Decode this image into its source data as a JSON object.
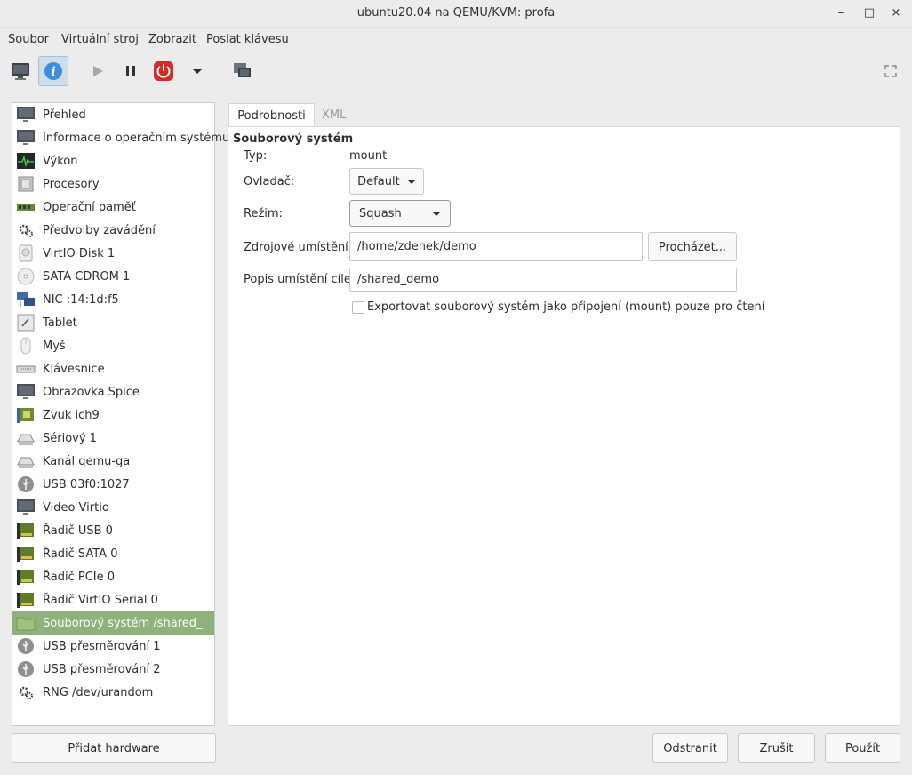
{
  "window": {
    "title": "ubuntu20.04 na QEMU/KVM: profa",
    "controls": [
      "–",
      "□",
      "×"
    ]
  },
  "menubar": {
    "items": [
      "Soubor",
      "Virtuální stroj",
      "Zobrazit",
      "Poslat klávesu"
    ]
  },
  "toolbar": {
    "buttons": [
      "console-icon",
      "info-icon",
      "play-icon",
      "pause-icon",
      "power-icon",
      "dropdown-arrow-icon",
      "snapshots-icon",
      "fullscreen-icon"
    ]
  },
  "sidebar": {
    "items": [
      {
        "label": "Přehled",
        "icon": "monitor-icon"
      },
      {
        "label": "Informace o operačním systému",
        "icon": "monitor-icon"
      },
      {
        "label": "Výkon",
        "icon": "performance-icon"
      },
      {
        "label": "Procesory",
        "icon": "cpu-icon"
      },
      {
        "label": "Operační paměť",
        "icon": "memory-icon"
      },
      {
        "label": "Předvolby zavádění",
        "icon": "gear-icon"
      },
      {
        "label": "VirtIO Disk 1",
        "icon": "disk-icon"
      },
      {
        "label": "SATA CDROM 1",
        "icon": "cdrom-icon"
      },
      {
        "label": "NIC :14:1d:f5",
        "icon": "network-icon"
      },
      {
        "label": "Tablet",
        "icon": "tablet-icon"
      },
      {
        "label": "Myš",
        "icon": "mouse-icon"
      },
      {
        "label": "Klávesnice",
        "icon": "keyboard-icon"
      },
      {
        "label": "Obrazovka Spice",
        "icon": "monitor-icon"
      },
      {
        "label": "Zvuk ich9",
        "icon": "sound-card-icon"
      },
      {
        "label": "Sériový 1",
        "icon": "serial-icon"
      },
      {
        "label": "Kanál qemu-ga",
        "icon": "serial-icon"
      },
      {
        "label": "USB 03f0:1027",
        "icon": "usb-icon"
      },
      {
        "label": "Video Virtio",
        "icon": "monitor-icon"
      },
      {
        "label": "Řadič USB 0",
        "icon": "controller-card-icon"
      },
      {
        "label": "Řadič SATA 0",
        "icon": "controller-card-icon"
      },
      {
        "label": "Řadič PCIe 0",
        "icon": "controller-card-icon"
      },
      {
        "label": "Řadič VirtIO Serial 0",
        "icon": "controller-card-icon"
      },
      {
        "label": "Souborový systém /shared_",
        "icon": "folder-icon",
        "selected": true
      },
      {
        "label": "USB přesměrování 1",
        "icon": "usb-icon"
      },
      {
        "label": "USB přesměrování 2",
        "icon": "usb-icon"
      },
      {
        "label": "RNG /dev/urandom",
        "icon": "gear-icon"
      }
    ],
    "add_hardware_label": "Přidat hardware"
  },
  "tabs": [
    {
      "label": "Podrobnosti",
      "active": true
    },
    {
      "label": "XML",
      "active": false
    }
  ],
  "details": {
    "section_title": "Souborový systém",
    "type_label": "Typ:",
    "type_value": "mount",
    "driver_label": "Ovladač:",
    "driver_value": "Default",
    "mode_label": "Režim:",
    "mode_value": "Squash",
    "source_label": "Zdrojové umístění:",
    "source_value": "/home/zdenek/demo",
    "browse_label": "Procházet...",
    "target_label": "Popis umístění cíle:",
    "target_value": "/shared_demo",
    "readonly_label": "Exportovat souborový systém jako připojení (mount) pouze pro čtení",
    "readonly_checked": false
  },
  "footer": {
    "remove_label": "Odstranit",
    "cancel_label": "Zrušit",
    "apply_label": "Použít"
  },
  "colors": {
    "selected_row": "#8fb17a",
    "power_red": "#d42a2a",
    "info_blue": "#3d8ee0"
  }
}
